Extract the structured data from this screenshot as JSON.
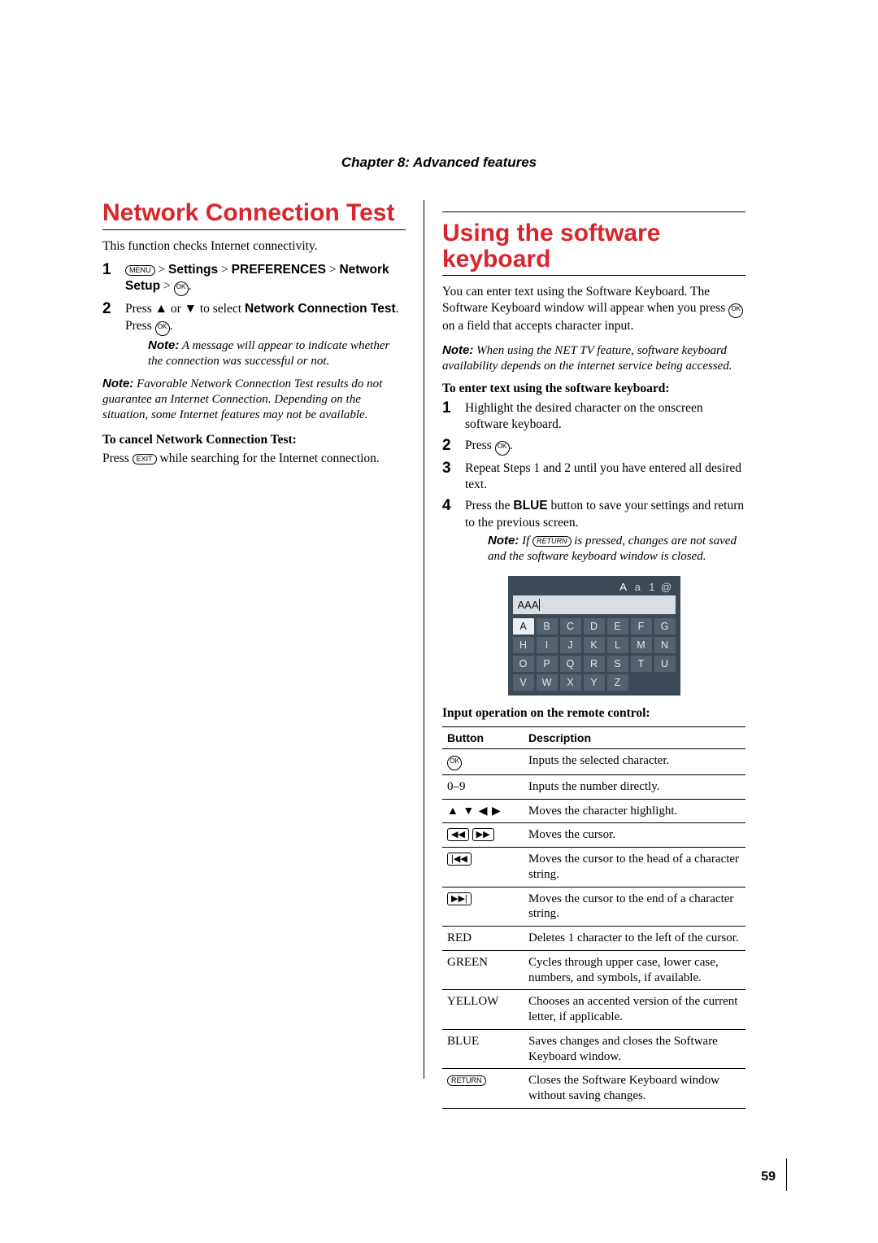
{
  "chapter_heading": "Chapter 8: Advanced features",
  "page_number": "59",
  "left": {
    "heading": "Network Connection Test",
    "intro": "This function checks Internet connectivity.",
    "step1": {
      "pre": "",
      "settings": "Settings",
      "preferences": "PREFERENCES",
      "network_setup": "Network Setup",
      "post": "."
    },
    "step2": {
      "line1_a": "Press ",
      "line1_b": " or ",
      "line1_c": " to select ",
      "target": "Network Connection Test",
      "line1_end": ". Press ",
      "press_end": "."
    },
    "step2_note": "A message will appear to indicate whether the connection was successful or not.",
    "note_main": "Favorable Network Connection Test results do not guarantee an Internet Connection. Depending on the situation, some Internet features may not be available.",
    "cancel_head": "To cancel Network Connection Test:",
    "cancel_body_a": "Press ",
    "cancel_body_b": " while searching for the Internet connection."
  },
  "right": {
    "heading": "Using the software keyboard",
    "intro_a": "You can enter text using the Software Keyboard. The Software Keyboard window will appear when you press ",
    "intro_b": " on a field that accepts character input.",
    "net_note": "When using the NET TV feature, software keyboard availability depends on the internet service being accessed.",
    "enter_head": "To enter text using the software keyboard:",
    "step1": "Highlight the desired character on the onscreen software keyboard.",
    "step2_a": "Press ",
    "step2_b": ".",
    "step3": "Repeat Steps 1 and 2 until you have entered all desired text.",
    "step4_a": "Press the ",
    "step4_blue": "BLUE",
    "step4_b": " button to save your settings and return to the previous screen.",
    "step4_note_a": "If ",
    "step4_note_b": " is pressed, changes are not saved and the software keyboard window is closed.",
    "kbd": {
      "modes": [
        "A",
        "a",
        "1",
        "@"
      ],
      "input": "AAA",
      "rows": [
        [
          "A",
          "B",
          "C",
          "D",
          "E",
          "F",
          "G"
        ],
        [
          "H",
          "I",
          "J",
          "K",
          "L",
          "M",
          "N"
        ],
        [
          "O",
          "P",
          "Q",
          "R",
          "S",
          "T",
          "U"
        ],
        [
          "V",
          "W",
          "X",
          "Y",
          "Z",
          "",
          ""
        ]
      ],
      "selected": "A"
    },
    "remote_head": "Input operation on the remote control:",
    "table": {
      "h1": "Button",
      "h2": "Description",
      "rows": [
        {
          "btn": "ok",
          "desc": "Inputs the selected character."
        },
        {
          "btn": "0-9",
          "desc": "Inputs the number directly.",
          "text": "0–9"
        },
        {
          "btn": "arrows",
          "desc": "Moves the character highlight."
        },
        {
          "btn": "rw-ff",
          "desc": "Moves the cursor."
        },
        {
          "btn": "prev",
          "desc": "Moves the cursor to the head of a character string."
        },
        {
          "btn": "next",
          "desc": "Moves the cursor to the end of a character string."
        },
        {
          "btn": "red",
          "desc": "Deletes 1 character to the left of the cursor.",
          "text": "RED"
        },
        {
          "btn": "green",
          "desc": "Cycles through upper case, lower case, numbers, and symbols, if available.",
          "text": "GREEN"
        },
        {
          "btn": "yellow",
          "desc": "Chooses an accented version of the current letter, if applicable.",
          "text": "YELLOW"
        },
        {
          "btn": "blue",
          "desc": "Saves changes and closes the Software Keyboard window.",
          "text": "BLUE"
        },
        {
          "btn": "return",
          "desc": "Closes the Software Keyboard window without saving changes."
        }
      ]
    }
  },
  "icons": {
    "menu": "MENU",
    "ok": "OK",
    "exit": "EXIT",
    "return": "RETURN"
  }
}
